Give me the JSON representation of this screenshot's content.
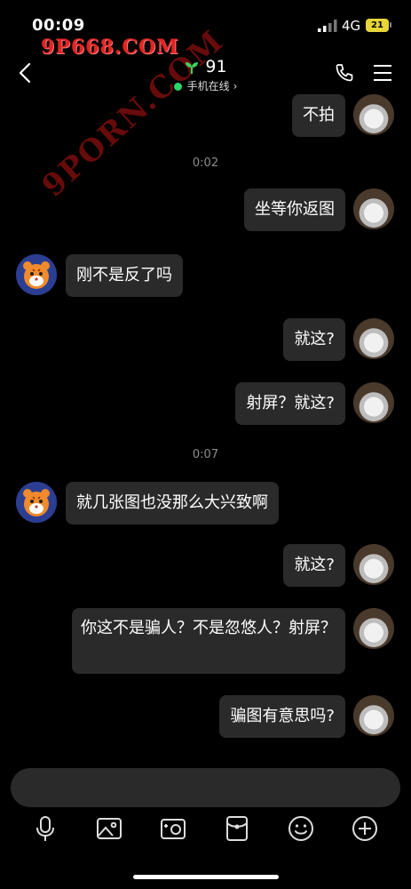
{
  "status_bar": {
    "time": "00:09",
    "network": "4G",
    "battery": "21"
  },
  "watermark": {
    "top_text": "9P668.COM",
    "diagonal_text": "9PORN.COM"
  },
  "header": {
    "title": "91",
    "presence": "手机在线",
    "presence_color": "#2bd66b",
    "icons": [
      "back-icon",
      "sprout-icon",
      "phone-icon",
      "menu-icon"
    ]
  },
  "messages": [
    {
      "kind": "message",
      "side": "right",
      "text": "不拍"
    },
    {
      "kind": "timestamp",
      "text": "0:02"
    },
    {
      "kind": "message",
      "side": "right",
      "text": "坐等你返图"
    },
    {
      "kind": "message",
      "side": "left",
      "text": "刚不是反了吗"
    },
    {
      "kind": "message",
      "side": "right",
      "text": "就这?"
    },
    {
      "kind": "message",
      "side": "right",
      "text": "射屏？就这?"
    },
    {
      "kind": "timestamp",
      "text": "0:07"
    },
    {
      "kind": "message",
      "side": "left",
      "text": "就几张图也没那么大兴致啊"
    },
    {
      "kind": "message",
      "side": "right",
      "text": "就这?"
    },
    {
      "kind": "message",
      "side": "right",
      "text": "你这不是骗人？不是忽悠人？射屏？"
    },
    {
      "kind": "message",
      "side": "right",
      "text": "骗图有意思吗?"
    }
  ],
  "toolbar": {
    "icons": [
      "mic-icon",
      "image-icon",
      "camera-icon",
      "red-packet-icon",
      "emoji-icon",
      "plus-icon"
    ]
  },
  "colors": {
    "background": "#000000",
    "bubble": "#2a2a2a",
    "timestamp": "#8d8d8d"
  }
}
